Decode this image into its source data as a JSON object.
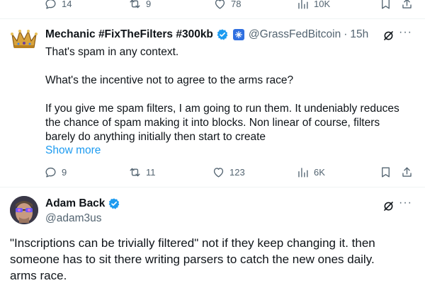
{
  "top_tweet_metrics": {
    "replies": "14",
    "retweets": "9",
    "likes": "78",
    "views": "10K"
  },
  "mechanic_tweet": {
    "display_name": "Mechanic #FixTheFilters #300kb",
    "handle": "@GrassFedBitcoin",
    "separator": "·",
    "time": "15h",
    "paragraph_1": "That's spam in any context.",
    "paragraph_2": "What's the incentive not to agree to the arms race?",
    "paragraph_3_line_1": "If you give me spam filters, I am going to run them. It undeniably reduces",
    "paragraph_3_line_2": "the chance of spam making it into blocks. Non linear of course, filters",
    "paragraph_3_line_3": "barely do anything initially then start to create",
    "show_more": "Show more",
    "metrics": {
      "replies": "9",
      "retweets": "11",
      "likes": "123",
      "views": "6K"
    }
  },
  "adam_tweet": {
    "display_name": "Adam Back",
    "handle": "@adam3us",
    "line_1": "\"Inscriptions can be trivially filtered\" not if they keep changing it. then",
    "line_2": "someone has to sit there writing parsers to catch the new ones daily.",
    "line_3": "arms race."
  },
  "icons": {
    "reply": "reply-icon",
    "retweet": "retweet-icon",
    "like": "heart-icon",
    "views": "views-icon",
    "bookmark": "bookmark-icon",
    "share": "share-icon",
    "grok": "grok-icon",
    "more": "more-dots-icon",
    "verified": "verified-badge-icon"
  },
  "colors": {
    "text": "#0f1419",
    "muted": "#536471",
    "link": "#1d9bf0",
    "verified": "#1d9bf0",
    "affiliate_badge": "#2f6fe0"
  }
}
